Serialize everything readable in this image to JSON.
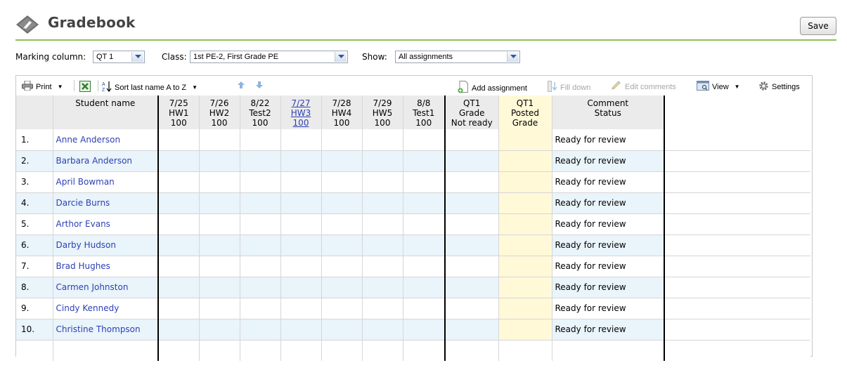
{
  "header": {
    "title": "Gradebook",
    "save_label": "Save"
  },
  "filters": {
    "marking_label": "Marking column:",
    "marking_value": "QT 1",
    "class_label": "Class:",
    "class_value": "1st PE-2, First Grade PE",
    "show_label": "Show:",
    "show_value": "All assignments"
  },
  "toolbar": {
    "print": "Print",
    "sort": "Sort last name A to Z",
    "add_assignment": "Add assignment",
    "fill_down": "Fill down",
    "edit_comments": "Edit comments",
    "view": "View",
    "settings": "Settings"
  },
  "columns": {
    "student": "Student name",
    "assignments": [
      {
        "date": "7/25",
        "name": "HW1",
        "points": "100"
      },
      {
        "date": "7/26",
        "name": "HW2",
        "points": "100"
      },
      {
        "date": "8/22",
        "name": "Test2",
        "points": "100"
      },
      {
        "date": "7/27",
        "name": "HW3",
        "points": "100"
      },
      {
        "date": "7/28",
        "name": "HW4",
        "points": "100"
      },
      {
        "date": "7/29",
        "name": "HW5",
        "points": "100"
      },
      {
        "date": "8/8",
        "name": "Test1",
        "points": "100"
      }
    ],
    "grade": {
      "line1": "QT1",
      "line2": "Grade",
      "line3": "Not ready"
    },
    "posted": {
      "line1": "QT1",
      "line2": "Posted",
      "line3": "Grade"
    },
    "comment": {
      "line1": "Comment",
      "line2": "Status"
    }
  },
  "students": [
    {
      "num": "1.",
      "name": "Anne Anderson",
      "status": "Ready for review"
    },
    {
      "num": "2.",
      "name": "Barbara Anderson",
      "status": "Ready for review"
    },
    {
      "num": "3.",
      "name": "April Bowman",
      "status": "Ready for review"
    },
    {
      "num": "4.",
      "name": "Darcie Burns",
      "status": "Ready for review"
    },
    {
      "num": "5.",
      "name": "Arthor Evans",
      "status": "Ready for review"
    },
    {
      "num": "6.",
      "name": "Darby Hudson",
      "status": "Ready for review"
    },
    {
      "num": "7.",
      "name": "Brad Hughes",
      "status": "Ready for review"
    },
    {
      "num": "8.",
      "name": "Carmen Johnston",
      "status": "Ready for review"
    },
    {
      "num": "9.",
      "name": "Cindy Kennedy",
      "status": "Ready for review"
    },
    {
      "num": "10.",
      "name": "Christine Thompson",
      "status": "Ready for review"
    }
  ],
  "colors": {
    "accent_line": "#8cc152",
    "link": "#2e3fb4",
    "row_alt": "#e9f4fb",
    "posted_bg": "#fff9d8"
  }
}
